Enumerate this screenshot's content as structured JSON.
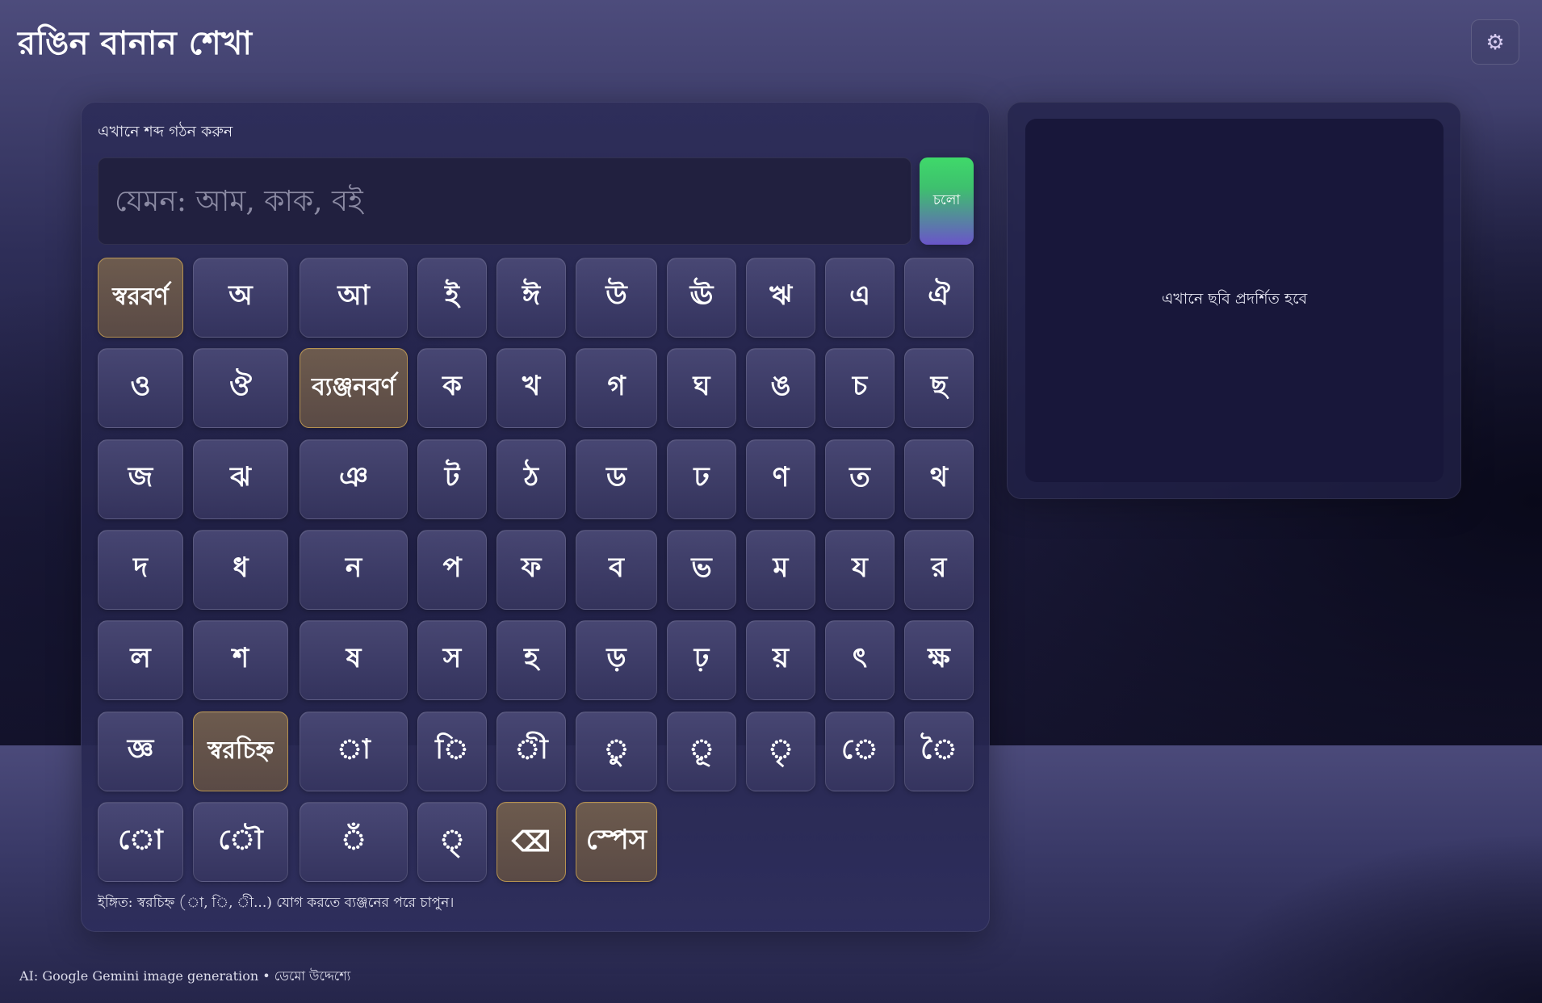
{
  "header": {
    "title": "রঙিন বানান শেখা",
    "settings_icon": "gear-icon"
  },
  "builder": {
    "label": "এখানে শব্দ গঠন করুন",
    "input_value": "",
    "input_placeholder": "যেমন: আম, কাক, বই",
    "go_label": "চলো"
  },
  "keyboard": {
    "rows": [
      [
        {
          "label": "স্বরবর্ণ",
          "kind": "section"
        },
        {
          "label": "অ"
        },
        {
          "label": "আ"
        },
        {
          "label": "ই"
        },
        {
          "label": "ঈ"
        },
        {
          "label": "উ"
        },
        {
          "label": "ঊ"
        },
        {
          "label": "ঋ"
        },
        {
          "label": "এ"
        },
        {
          "label": "ঐ"
        }
      ],
      [
        {
          "label": "ও"
        },
        {
          "label": "ঔ"
        },
        {
          "label": "ব্যঞ্জনবর্ণ",
          "kind": "section"
        },
        {
          "label": "ক"
        },
        {
          "label": "খ"
        },
        {
          "label": "গ"
        },
        {
          "label": "ঘ"
        },
        {
          "label": "ঙ"
        },
        {
          "label": "চ"
        },
        {
          "label": "ছ"
        }
      ],
      [
        {
          "label": "জ"
        },
        {
          "label": "ঝ"
        },
        {
          "label": "ঞ"
        },
        {
          "label": "ট"
        },
        {
          "label": "ঠ"
        },
        {
          "label": "ড"
        },
        {
          "label": "ঢ"
        },
        {
          "label": "ণ"
        },
        {
          "label": "ত"
        },
        {
          "label": "থ"
        }
      ],
      [
        {
          "label": "দ"
        },
        {
          "label": "ধ"
        },
        {
          "label": "ন"
        },
        {
          "label": "প"
        },
        {
          "label": "ফ"
        },
        {
          "label": "ব"
        },
        {
          "label": "ভ"
        },
        {
          "label": "ম"
        },
        {
          "label": "য"
        },
        {
          "label": "র"
        }
      ],
      [
        {
          "label": "ল"
        },
        {
          "label": "শ"
        },
        {
          "label": "ষ"
        },
        {
          "label": "স"
        },
        {
          "label": "হ"
        },
        {
          "label": "ড়"
        },
        {
          "label": "ঢ়"
        },
        {
          "label": "য়"
        },
        {
          "label": "ৎ"
        },
        {
          "label": "ক্ষ"
        }
      ],
      [
        {
          "label": "জ্ঞ"
        },
        {
          "label": "স্বরচিহ্ন",
          "kind": "section"
        },
        {
          "label": "া"
        },
        {
          "label": "ি"
        },
        {
          "label": "ী"
        },
        {
          "label": "ু"
        },
        {
          "label": "ূ"
        },
        {
          "label": "ৃ"
        },
        {
          "label": "ে"
        },
        {
          "label": "ৈ"
        }
      ],
      [
        {
          "label": "ো"
        },
        {
          "label": "ৌ"
        },
        {
          "label": "ঁ"
        },
        {
          "label": "্"
        },
        {
          "label": "⌫",
          "kind": "special",
          "icon": "backspace-icon"
        },
        {
          "label": "স্পেস",
          "kind": "special"
        }
      ]
    ],
    "hint": "ইঙ্গিত: স্বরচিহ্ন (া, ি, ী...) যোগ করতে ব্যঞ্জনের পরে চাপুন।"
  },
  "preview": {
    "placeholder": "এখানে ছবি প্রদর্শিত হবে"
  },
  "footer": {
    "text": "AI: Google Gemini image generation • ডেমো উদ্দেশ্যে"
  },
  "colors": {
    "accent_go_top": "#3fd96a",
    "accent_go_bottom": "#6a55c9",
    "section_key_border": "#b69250",
    "section_key_bg": "#6d5b4e",
    "background_top": "#4d4c7c",
    "background_bottom": "#14132c"
  }
}
